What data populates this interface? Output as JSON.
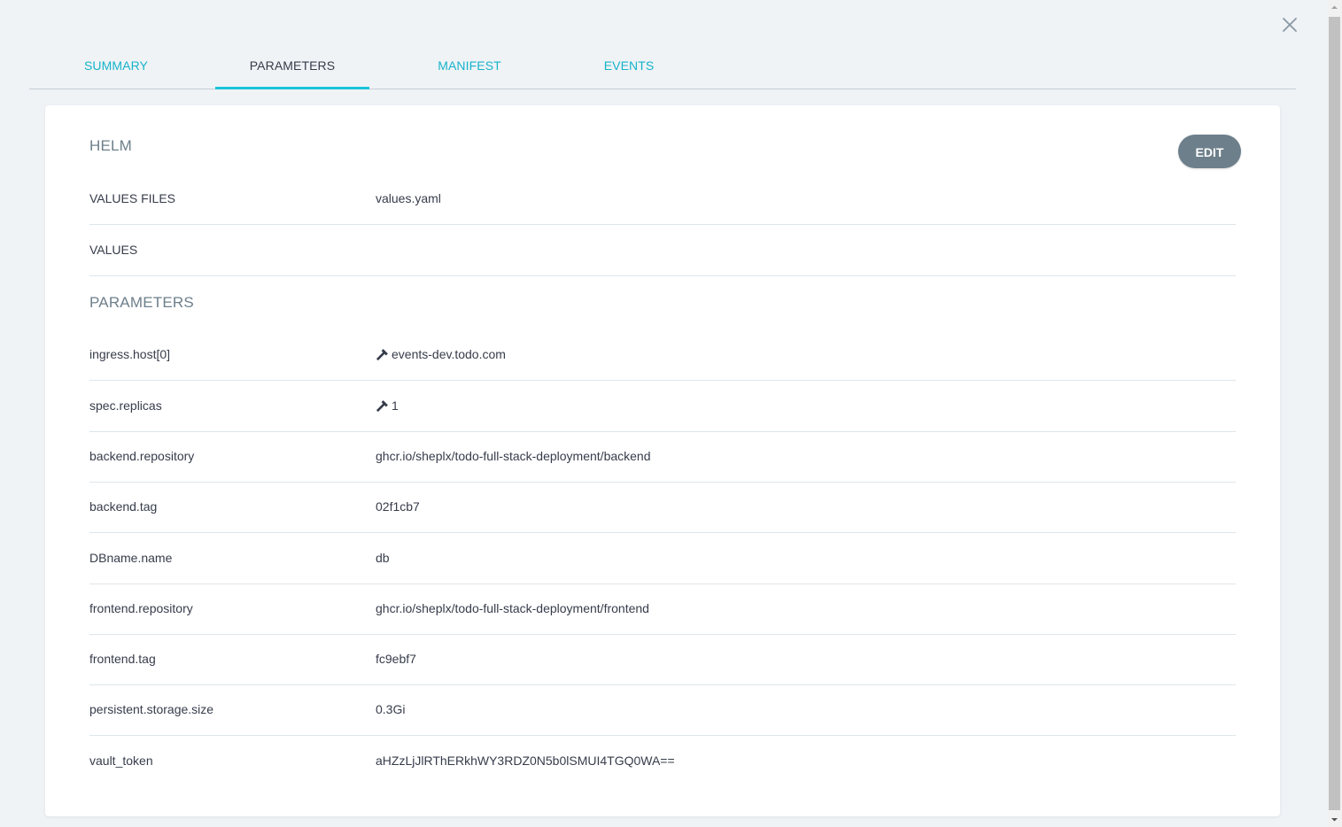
{
  "tabs": [
    {
      "label": "SUMMARY",
      "active": false
    },
    {
      "label": "PARAMETERS",
      "active": true
    },
    {
      "label": "MANIFEST",
      "active": false
    },
    {
      "label": "EVENTS",
      "active": false
    }
  ],
  "card": {
    "edit_label": "EDIT",
    "helm_title": "HELM",
    "helm_rows": [
      {
        "key": "VALUES FILES",
        "value": "values.yaml"
      },
      {
        "key": "VALUES",
        "value": ""
      }
    ],
    "parameters_title": "PARAMETERS",
    "parameters": [
      {
        "key": "ingress.host[0]",
        "value": "events-dev.todo.com",
        "overridden": true
      },
      {
        "key": "spec.replicas",
        "value": "1",
        "overridden": true
      },
      {
        "key": "backend.repository",
        "value": "ghcr.io/sheplx/todo-full-stack-deployment/backend",
        "overridden": false
      },
      {
        "key": "backend.tag",
        "value": "02f1cb7",
        "overridden": false
      },
      {
        "key": "DBname.name",
        "value": "db",
        "overridden": false
      },
      {
        "key": "frontend.repository",
        "value": "ghcr.io/sheplx/todo-full-stack-deployment/frontend",
        "overridden": false
      },
      {
        "key": "frontend.tag",
        "value": "fc9ebf7",
        "overridden": false
      },
      {
        "key": "persistent.storage.size",
        "value": "0.3Gi",
        "overridden": false
      },
      {
        "key": "vault_token",
        "value": "aHZzLjJlRThERkhWY3RDZ0N5b0lSMUI4TGQ0WA==",
        "overridden": false
      }
    ]
  },
  "icons": {
    "close": "close-icon",
    "override": "hammer-icon"
  },
  "colors": {
    "accent": "#17b3c9",
    "tab_underline": "#1ac3db",
    "edit_button": "#6d7f8b",
    "background": "#eff3f6"
  }
}
